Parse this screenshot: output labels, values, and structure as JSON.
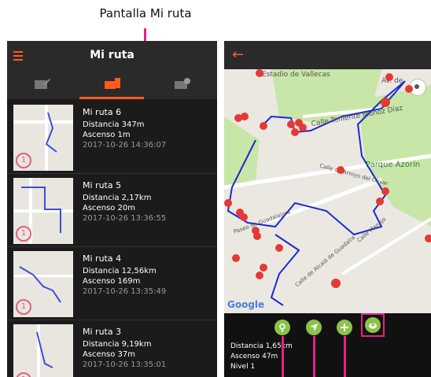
{
  "caption": "Pantalla Mi ruta",
  "left_screen": {
    "title": "Mi ruta",
    "routes": [
      {
        "name": "Mi ruta 6",
        "distance": "Distancia  347m",
        "ascent": "Ascenso  1m",
        "date": "2017-10-26 14:36:07"
      },
      {
        "name": "Mi ruta 5",
        "distance": "Distancia  2,17km",
        "ascent": "Ascenso  20m",
        "date": "2017-10-26 13:36:55"
      },
      {
        "name": "Mi ruta 4",
        "distance": "Distancia  12,56km",
        "ascent": "Ascenso  169m",
        "date": "2017-10-26 13:35:49"
      },
      {
        "name": "Mi ruta 3",
        "distance": "Distancia  9,19km",
        "ascent": "Ascenso  37m",
        "date": "2017-10-26 13:35:01"
      }
    ],
    "thumb_marker": "1"
  },
  "right_screen": {
    "map_labels": {
      "estadio": "Estadio de Vallecas",
      "park": "Parque Azorín",
      "street1": "Calle Teniente Muñoz Díaz",
      "street2": "Av. de",
      "street3": "Paseo de Guadalajara",
      "street4": "Calle Manojo",
      "street5": "Calle de Arroyo del Olivar",
      "street6": "Calle de Alcalá de Guadaíra",
      "google": "Google"
    },
    "stats": {
      "distance": "Distancia  1,65km",
      "ascent": "Ascenso  47m",
      "level": "Nivel  1"
    }
  },
  "colors": {
    "accent": "#ff5a1f",
    "highlight": "#e91e8c",
    "fab": "#8bc34a",
    "route": "#1a2bd0",
    "marker": "#e53935"
  }
}
